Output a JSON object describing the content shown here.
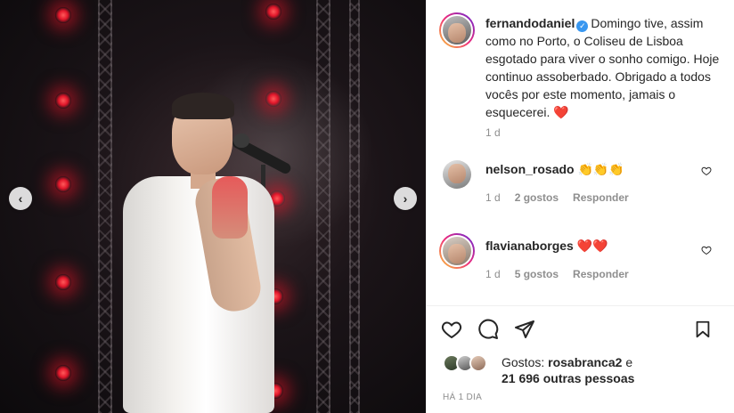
{
  "post": {
    "author": {
      "username": "fernandodaniel",
      "verified": true
    },
    "caption": {
      "text": "Domingo tive, assim como no Porto, o Coliseu de Lisboa esgotado para viver o sonho comigo. Hoje continuo assoberbado. Obrigado a todos vocês por este momento, jamais o esquecerei.",
      "emoji": "❤️"
    },
    "caption_age": "1 d",
    "post_age": "HÁ 1 DIA"
  },
  "media": {
    "prev_icon": "chevron-left-icon",
    "next_icon": "chevron-right-icon",
    "prev_glyph": "‹",
    "next_glyph": "›"
  },
  "comments": [
    {
      "username": "nelson_rosado",
      "text": "👏👏👏",
      "age": "1 d",
      "likes": "2 gostos",
      "reply": "Responder"
    },
    {
      "username": "flavianaborges",
      "text": "❤️❤️",
      "age": "1 d",
      "likes": "5 gostos",
      "reply": "Responder"
    }
  ],
  "likes": {
    "prefix": "Gostos:",
    "first_user": "rosabranca2",
    "connector": "e",
    "others": "21 696 outras pessoas"
  },
  "colors": {
    "accent_verified": "#3897f0",
    "heart": "#ed4956",
    "muted": "#8e8e8e",
    "text": "#262626"
  }
}
